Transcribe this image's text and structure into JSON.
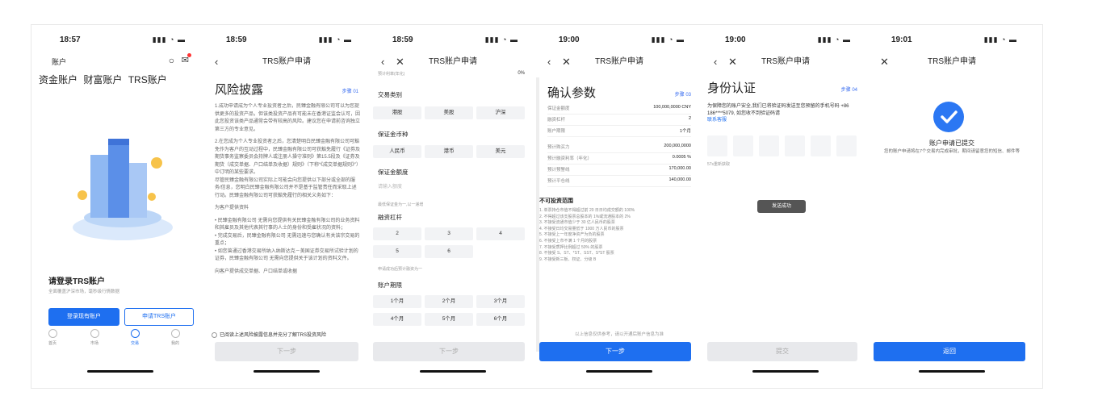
{
  "screens": [
    {
      "time": "18:57"
    },
    {
      "time": "18:59"
    },
    {
      "time": "18:59"
    },
    {
      "time": "19:00"
    },
    {
      "time": "19:00"
    },
    {
      "time": "19:01"
    }
  ],
  "s1": {
    "nav_title": "账户",
    "tabs": [
      "资金账户",
      "财富账户",
      "TRS账户"
    ],
    "login_title": "请登录TRS账户",
    "login_sub": "全面覆盖沪深市场，毫秒级行情数据",
    "login_btn": "登录现有账户",
    "apply_btn": "申请TRS账户",
    "bottom_tabs": [
      "首页",
      "市场",
      "交易",
      "我的"
    ]
  },
  "s2": {
    "title": "TRS账户申请",
    "heading": "风险披露",
    "step": "步骤 01",
    "paras": [
      "1.成功申请成为个人专业投资者之后，民臻金融有限公司可以为您提供更多的投资产品，但该类投资产品有可能未在香港证监会认可，因此您投资该类产品通常会带有较高的风险。建议您在申请前咨询独立第三方的专业意见。",
      "2.在您成为个人专业投资者之后，您清楚明白民臻金融有限公司可豁免作为客户的互动过程中，民臻金融有限公司可获豁免履行《证券及期货事务监察委员会持牌人或注册人操守准则》第15.5段及《证券及期货（成交单据、户口结单及收据）规则》（下称“《成交单据规则》”）中订明的某些要求。",
      "尽管民臻金融有限公司实际上可能会向您提供以下部分或全部的服务/信息，您明白民臻金融有限公司并不是基于监管责任而采取上述行动。民臻金融有限公司可获豁免履行的相关义务如下：",
      "为客户提供资料",
      "• 民臻金融有限公司 无需向您提供有关民臻金融有限公司的业务资料和其雇员及其他代表其行事的人士的身份和受雇状况的资料；",
      "• 完成交易后，民臻金融有限公司 无需迅速与您确认有关该宗交易的重点；",
      "• 如您曾通过香港交易所纳入纳斯达克－美国证券交易所试验计划的证券，民臻金融有限公司 无需向您提供关于该计划的资料文件。",
      "向客户提供成交单据、户口结单或收据"
    ],
    "agree": "已阅读上述风险披露信息并充分了解TRS投资风险",
    "next": "下一步"
  },
  "s3": {
    "title": "TRS账户申请",
    "pre_label": "预计利率(年化)",
    "pre_val": "0%",
    "g1": "交易类别",
    "g1o": [
      "港股",
      "美股",
      "沪深"
    ],
    "g2": "保证金币种",
    "g2o": [
      "人民币",
      "港币",
      "美元"
    ],
    "g3": "保证金额度",
    "g3_ph": "请输入额度",
    "g3_hint": "最低保证金为一,以一递增",
    "g4": "融资杠杆",
    "g4o": [
      "2",
      "3",
      "4",
      "5",
      "6"
    ],
    "g4_hint": "申请成功后预计融资为一",
    "g5": "账户期限",
    "g5o": [
      "1个月",
      "2个月",
      "3个月",
      "4个月",
      "5个月",
      "6个月"
    ],
    "next": "下一步"
  },
  "s4": {
    "title": "TRS账户申请",
    "heading": "确认参数",
    "step": "步骤 03",
    "rows": [
      [
        "保证金额度",
        "100,000,0000 CNY"
      ],
      [
        "融资杠杆",
        "2"
      ],
      [
        "账户期限",
        "1个月"
      ],
      [
        "预计购买力",
        "200,000,0000"
      ],
      [
        "预计融资利率（年化）",
        "0.0005 %"
      ],
      [
        "预计预警线",
        "170,000.00"
      ],
      [
        "预计平仓线",
        "140,000.00"
      ]
    ],
    "scope_title": "不可投资范围",
    "scope": [
      "1. 单票持仓市值不得超过前 20 日日均成交额的 100%",
      "2. 不得超过该支股票总股本的 1%或流通股本的 2%",
      "3. 不接受流通市值少于 30 亿人民币的股票",
      "4. 不接受日均交易量低于 1000 万人民币的股票",
      "5. 不接受上一年度净资产为负的股票",
      "6. 不接受上市不满 1 个月的股票",
      "7. 不接受质押比例超过 50% 的股票",
      "8. 不接受 S、ST、*ST、SST、S*ST 股票",
      "9. 不接受新三板、权证、分级 B"
    ],
    "note": "以上信息仅供参考，请以开通后账户信息为准",
    "next": "下一步"
  },
  "s5": {
    "title": "TRS账户申请",
    "heading": "身份认证",
    "step": "步骤 04",
    "desc": "为保障您的账户安全,我们已将验证码发送至您预留的手机号码 +86 186****5079, 如您收不到验证码请",
    "link": "联系客服",
    "countdown": "57s重新获取",
    "toast": "发送成功",
    "submit": "提交"
  },
  "s6": {
    "title": "TRS账户申请",
    "status": "账户申请已提交",
    "desc": "您的账户申请将在7个交易内完成审批，期间请留意您的短信、邮件等",
    "back": "返回"
  }
}
